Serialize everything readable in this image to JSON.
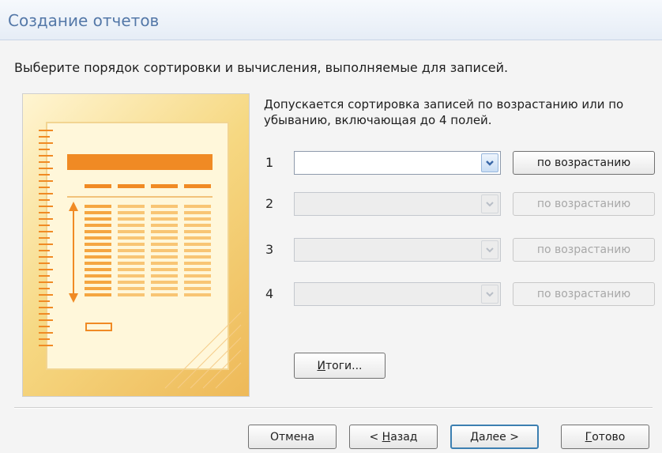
{
  "window": {
    "title": "Создание отчетов"
  },
  "instruction": "Выберите порядок сортировки и вычисления, выполняемые для записей.",
  "description": {
    "line1": "Допускается сортировка записей по возрастанию или по",
    "line2": "убыванию, включающая до 4 полей."
  },
  "sort_rows": [
    {
      "number": "1",
      "field_value": "",
      "order_label": "по возрастанию",
      "enabled": true
    },
    {
      "number": "2",
      "field_value": "",
      "order_label": "по возрастанию",
      "enabled": false
    },
    {
      "number": "3",
      "field_value": "",
      "order_label": "по возрастанию",
      "enabled": false
    },
    {
      "number": "4",
      "field_value": "",
      "order_label": "по возрастанию",
      "enabled": false
    }
  ],
  "totals_button": {
    "label_accel": "И",
    "label_rest": "тоги..."
  },
  "footer": {
    "cancel": {
      "label": "Отмена"
    },
    "back": {
      "prefix": "< ",
      "accel": "Н",
      "rest": "азад"
    },
    "next": {
      "accel": "Д",
      "rest": "алее >"
    },
    "finish": {
      "accel": "Г",
      "rest": "отово"
    }
  },
  "colors": {
    "header_title": "#5478a8",
    "illustration_accent": "#f08a24",
    "default_button_border": "#3c7fb1"
  },
  "icons": {
    "dropdown": "chevron-down-icon",
    "illustration": "report-sort-illustration"
  }
}
